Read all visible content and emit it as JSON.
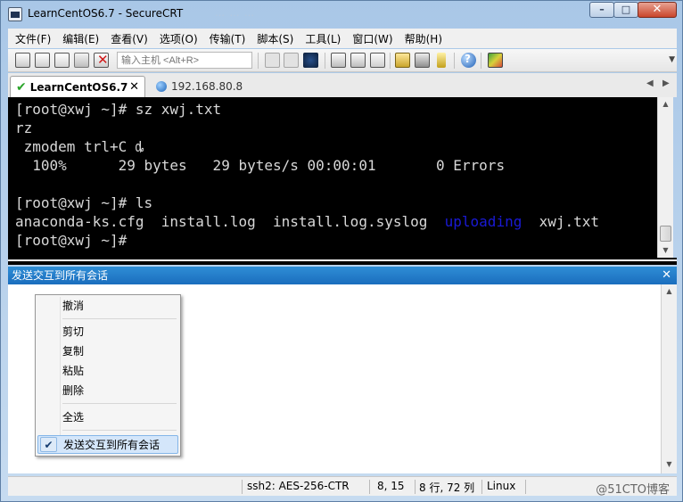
{
  "window": {
    "title": "LearnCentOS6.7 - SecureCRT",
    "faint_title": "… … …"
  },
  "menu": [
    "文件(F)",
    "编辑(E)",
    "查看(V)",
    "选项(O)",
    "传输(T)",
    "脚本(S)",
    "工具(L)",
    "窗口(W)",
    "帮助(H)"
  ],
  "toolbar": {
    "command_placeholder": "输入主机 <Alt+R>"
  },
  "tabs": {
    "active": "LearnCentOS6.7",
    "inactive": "192.168.80.8"
  },
  "terminal": {
    "lines": [
      "[root@xwj ~]# sz xwj.txt",
      "rz",
      " zmodem trl+C ȡ",
      "  100%      29 bytes   29 bytes/s 00:00:01       0 Errors",
      "",
      "[root@xwj ~]# ls",
      "anaconda-ks.cfg  install.log  install.log.syslog  ",
      "[root@xwj ~]#"
    ],
    "ls_highlight": "uploading",
    "ls_tail": "  xwj.txt"
  },
  "panel": {
    "title": "发送交互到所有会话"
  },
  "context_menu": {
    "items": [
      "撤消",
      "剪切",
      "复制",
      "粘贴",
      "删除",
      "全选",
      "发送交互到所有会话"
    ]
  },
  "status": {
    "ssh": "ssh2: AES-256-CTR",
    "pos": "8,  15",
    "size": "8 行, 72 列",
    "os": "Linux",
    "watermark": "@51CTO博客"
  }
}
